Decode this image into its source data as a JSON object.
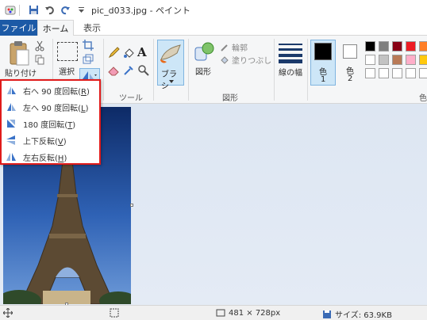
{
  "titlebar": {
    "title": "pic_d033.jpg - ペイント"
  },
  "tabs": {
    "file": "ファイル",
    "home": "ホーム",
    "view": "表示"
  },
  "ribbon": {
    "clipboard": {
      "paste": "貼り付け"
    },
    "image": {
      "select": "選択"
    },
    "tools": {
      "label": "ツール"
    },
    "brush": {
      "label": "ブラシ"
    },
    "shapes": {
      "label": "図形",
      "shapes_button": "図形",
      "outline": "輪郭",
      "fill": "塗りつぶし"
    },
    "size": {
      "label": "線の幅"
    },
    "color1": {
      "label": "色",
      "number": "1",
      "value": "#000000"
    },
    "color2": {
      "label": "色",
      "number": "2",
      "value": "#ffffff"
    },
    "colors_group_label": "色",
    "palette_row1": [
      "#000000",
      "#7f7f7f",
      "#880015",
      "#ed1c24",
      "#ff7f27"
    ],
    "palette_row2": [
      "#ffffff",
      "#c3c3c3",
      "#b97a57",
      "#ffaec9",
      "#ffc90e"
    ]
  },
  "rotate_menu": {
    "items": [
      {
        "label": "右へ 90 度回転(",
        "key": "R",
        "suffix": ")"
      },
      {
        "label": "左へ 90 度回転(",
        "key": "L",
        "suffix": ")"
      },
      {
        "label": "180 度回転(",
        "key": "T",
        "suffix": ")"
      },
      {
        "label": "上下反転(",
        "key": "V",
        "suffix": ")"
      },
      {
        "label": "左右反転(",
        "key": "H",
        "suffix": ")"
      }
    ]
  },
  "statusbar": {
    "dimensions": "481 × 728px",
    "filesize": "サイズ: 63.9KB"
  },
  "colors": {
    "accent": "#1c5aa6",
    "menu_border": "#e01b1b"
  }
}
